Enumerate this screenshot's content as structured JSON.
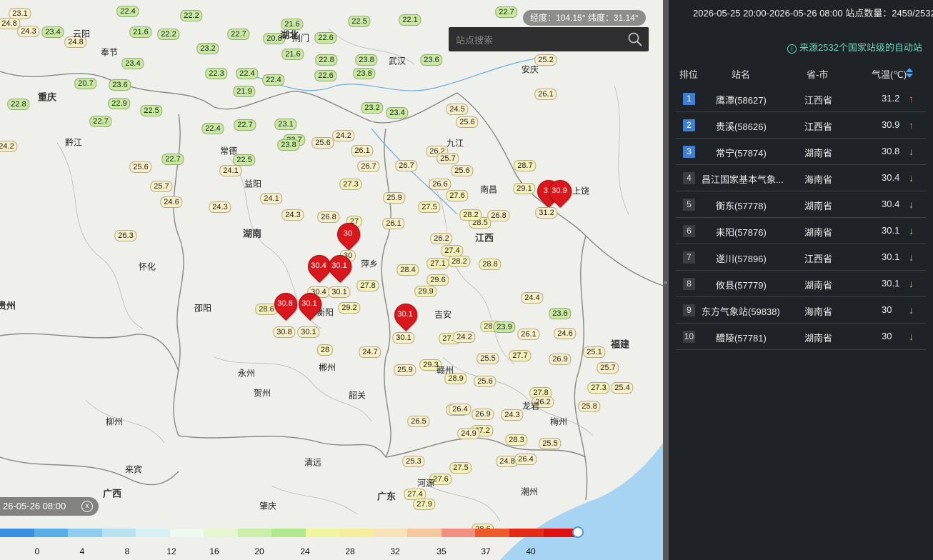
{
  "search": {
    "placeholder": "站点搜索"
  },
  "coords_text": "经度：104.15°  纬度：31.14°",
  "timeline": {
    "label": "26-05-26 08:00",
    "close": "x"
  },
  "colorbar": {
    "colors": [
      "#3a8fe0",
      "#5aaee8",
      "#8fcdf0",
      "#b8e2f2",
      "#d6f0f4",
      "#eefaf0",
      "#e6f7d0",
      "#cbefa8",
      "#b2e88c",
      "#eef6a0",
      "#f6ee9c",
      "#f8e2b8",
      "#f6c8a0",
      "#f19080",
      "#ef5a2a",
      "#e52a16",
      "#e01010"
    ],
    "ticks": [
      "0",
      "4",
      "8",
      "12",
      "16",
      "20",
      "24",
      "28",
      "32",
      "35",
      "37",
      "40"
    ]
  },
  "panel": {
    "period": "2026-05-25 20:00-2026-05-26 08:00  站点数量：2459/2532",
    "source": "来源2532个国家站级的自动站",
    "info_icon": "i",
    "headers": {
      "rank": "排位",
      "name": "站名",
      "province": "省-市",
      "temp": "气温(℃)"
    },
    "sort_icon": "sort-icon",
    "rows": [
      {
        "rank": "1",
        "name": "鹰潭(58627)",
        "province": "江西省",
        "temp": "31.2",
        "trend": "↑",
        "dir": "up"
      },
      {
        "rank": "2",
        "name": "贵溪(58626)",
        "province": "江西省",
        "temp": "30.9",
        "trend": "↑",
        "dir": "up"
      },
      {
        "rank": "3",
        "name": "常宁(57874)",
        "province": "湖南省",
        "temp": "30.8",
        "trend": "↓",
        "dir": "down"
      },
      {
        "rank": "4",
        "name": "昌江国家基本气象...",
        "province": "海南省",
        "temp": "30.4",
        "trend": "↓",
        "dir": "down"
      },
      {
        "rank": "5",
        "name": "衡东(57778)",
        "province": "湖南省",
        "temp": "30.4",
        "trend": "↓",
        "dir": "down"
      },
      {
        "rank": "6",
        "name": "耒阳(57876)",
        "province": "湖南省",
        "temp": "30.1",
        "trend": "↓",
        "dir": "down"
      },
      {
        "rank": "7",
        "name": "遂川(57896)",
        "province": "江西省",
        "temp": "30.1",
        "trend": "↓",
        "dir": "down"
      },
      {
        "rank": "8",
        "name": "攸县(57779)",
        "province": "湖南省",
        "temp": "30.1",
        "trend": "↓",
        "dir": "down"
      },
      {
        "rank": "9",
        "name": "东方气象站(59838)",
        "province": "海南省",
        "temp": "30",
        "trend": "↓",
        "dir": "down"
      },
      {
        "rank": "10",
        "name": "醴陵(57781)",
        "province": "湖南省",
        "temp": "30",
        "trend": "↓",
        "dir": "down"
      }
    ]
  },
  "map": {
    "places": [
      {
        "t": "湖北"
      },
      {
        "t": "重庆"
      },
      {
        "t": "湖南"
      },
      {
        "t": "江西"
      },
      {
        "t": "福建"
      },
      {
        "t": "广西"
      },
      {
        "t": "贵州"
      },
      {
        "t": "荆门"
      },
      {
        "t": "云阳"
      },
      {
        "t": "奉节"
      },
      {
        "t": "黔江"
      },
      {
        "t": "常德"
      },
      {
        "t": "益阳"
      },
      {
        "t": "萍乡"
      },
      {
        "t": "永州"
      },
      {
        "t": "郴州"
      },
      {
        "t": "赣州"
      },
      {
        "t": "龙岩"
      },
      {
        "t": "河源"
      },
      {
        "t": "梅州"
      },
      {
        "t": "潮州"
      },
      {
        "t": "韶关"
      },
      {
        "t": "清远"
      },
      {
        "t": "肇庆"
      },
      {
        "t": "来宾"
      },
      {
        "t": "柳州"
      },
      {
        "t": "贺州"
      },
      {
        "t": "九江"
      },
      {
        "t": "上饶"
      },
      {
        "t": "南昌"
      },
      {
        "t": "衡阳"
      },
      {
        "t": "怀化"
      },
      {
        "t": "安庆"
      },
      {
        "t": "武汉"
      },
      {
        "t": "邵阳"
      },
      {
        "t": "吉安"
      },
      {
        "t": "广东"
      }
    ],
    "pins": [
      {
        "v": "30",
        "sub": "30"
      },
      {
        "v": "30.4",
        "sub": "30.4"
      },
      {
        "v": "30.1",
        "sub": "30.1"
      },
      {
        "v": "30.8",
        "sub": "30.8"
      },
      {
        "v": "30.1",
        "sub": "30.1"
      },
      {
        "v": "30.1",
        "sub": "30.1"
      },
      {
        "v": "31",
        "sub": "31.2"
      },
      {
        "v": "30.9",
        "sub": ""
      }
    ],
    "temps": [
      [
        "23.1",
        "cream"
      ],
      [
        "22.4",
        "green"
      ],
      [
        "22.2",
        "green"
      ],
      [
        "24.8",
        "cream"
      ],
      [
        "22.2",
        "green"
      ],
      [
        "21.6",
        "green"
      ],
      [
        "23.4",
        "green"
      ],
      [
        "21.6",
        "green"
      ],
      [
        "20.8",
        "green"
      ],
      [
        "22.6",
        "green"
      ],
      [
        "22.5",
        "green"
      ],
      [
        "22.1",
        "green"
      ],
      [
        "22.7",
        "green"
      ],
      [
        "22.7",
        "green"
      ],
      [
        "24.3",
        "cream"
      ],
      [
        "24.8",
        "cream"
      ],
      [
        "23.4",
        "green"
      ],
      [
        "23.2",
        "green"
      ],
      [
        "22.8",
        "green"
      ],
      [
        "21.6",
        "green"
      ],
      [
        "23.8",
        "green"
      ],
      [
        "23.6",
        "green"
      ],
      [
        "25.2",
        "cream"
      ],
      [
        "23.8",
        "green"
      ],
      [
        "22.3",
        "green"
      ],
      [
        "22.4",
        "green"
      ],
      [
        "21.9",
        "green"
      ],
      [
        "22.4",
        "green"
      ],
      [
        "20.7",
        "green"
      ],
      [
        "23.6",
        "green"
      ],
      [
        "22.8",
        "green"
      ],
      [
        "22.6",
        "green"
      ],
      [
        "22.9",
        "green"
      ],
      [
        "22.5",
        "green"
      ],
      [
        "24.5",
        "cream"
      ],
      [
        "23.2",
        "green"
      ],
      [
        "23.4",
        "green"
      ],
      [
        "25.6",
        "cream"
      ],
      [
        "26.1",
        "cream"
      ],
      [
        "24.2",
        "cream"
      ],
      [
        "22.7",
        "green"
      ],
      [
        "22.4",
        "green"
      ],
      [
        "22.7",
        "green"
      ],
      [
        "23.1",
        "green"
      ],
      [
        "24.2",
        "cream"
      ],
      [
        "23.7",
        "green"
      ],
      [
        "22.5",
        "green"
      ],
      [
        "23.8",
        "green"
      ],
      [
        "24.1",
        "cream"
      ],
      [
        "25.6",
        "cream"
      ],
      [
        "22.7",
        "green"
      ],
      [
        "25.6",
        "cream"
      ],
      [
        "26.2",
        "cream"
      ],
      [
        "26.7",
        "cream"
      ],
      [
        "24.1",
        "cream"
      ],
      [
        "24.3",
        "cream"
      ],
      [
        "24.6",
        "cream"
      ],
      [
        "25.7",
        "cream"
      ],
      [
        "24.3",
        "cream"
      ],
      [
        "26.3",
        "cream"
      ],
      [
        "26.8",
        "cream"
      ],
      [
        "25.9",
        "cream"
      ],
      [
        "27",
        "yellow"
      ],
      [
        "27.3",
        "yellow"
      ],
      [
        "26.2",
        "cream"
      ],
      [
        "26.6",
        "cream"
      ],
      [
        "25.6",
        "cream"
      ],
      [
        "27.5",
        "yellow"
      ],
      [
        "26.1",
        "cream"
      ],
      [
        "27.6",
        "yellow"
      ],
      [
        "28.7",
        "yellow"
      ],
      [
        "29.1",
        "yellow"
      ],
      [
        "28.4",
        "yellow"
      ],
      [
        "27.4",
        "yellow"
      ],
      [
        "27.1",
        "yellow"
      ],
      [
        "28.2",
        "yellow"
      ],
      [
        "28.8",
        "yellow"
      ],
      [
        "27.8",
        "yellow"
      ],
      [
        "29.6",
        "yellow"
      ],
      [
        "29.9",
        "yellow"
      ],
      [
        "28.5",
        "yellow"
      ],
      [
        "28.2",
        "yellow"
      ],
      [
        "29.3",
        "yellow"
      ],
      [
        "28.9",
        "yellow"
      ],
      [
        "27.9",
        "yellow"
      ],
      [
        "28.7",
        "yellow"
      ],
      [
        "29.2",
        "yellow"
      ],
      [
        "28.6",
        "yellow"
      ],
      [
        "28",
        "yellow"
      ],
      [
        "26.7",
        "cream"
      ],
      [
        "26.1",
        "cream"
      ],
      [
        "25.7",
        "cream"
      ],
      [
        "26.8",
        "cream"
      ],
      [
        "24.7",
        "cream"
      ],
      [
        "25.9",
        "cream"
      ],
      [
        "27.7",
        "yellow"
      ],
      [
        "26.6",
        "cream"
      ],
      [
        "27.2",
        "yellow"
      ],
      [
        "28.3",
        "yellow"
      ],
      [
        "26.9",
        "cream"
      ],
      [
        "27.8",
        "yellow"
      ],
      [
        "26.5",
        "cream"
      ],
      [
        "25.3",
        "cream"
      ],
      [
        "24.8",
        "cream"
      ],
      [
        "26.4",
        "cream"
      ],
      [
        "25.5",
        "cream"
      ],
      [
        "24.9",
        "cream"
      ],
      [
        "24.3",
        "cream"
      ],
      [
        "26.2",
        "cream"
      ],
      [
        "25.8",
        "cream"
      ],
      [
        "25.7",
        "cream"
      ],
      [
        "27.3",
        "yellow"
      ],
      [
        "26.9",
        "cream"
      ],
      [
        "24.6",
        "cream"
      ],
      [
        "25.1",
        "cream"
      ],
      [
        "25.4",
        "cream"
      ],
      [
        "23.6",
        "green"
      ],
      [
        "26.1",
        "cream"
      ],
      [
        "25.6",
        "cream"
      ],
      [
        "24.2",
        "cream"
      ],
      [
        "24.4",
        "cream"
      ],
      [
        "23.9",
        "green"
      ],
      [
        "25.5",
        "cream"
      ],
      [
        "26.4",
        "cream"
      ],
      [
        "27.6",
        "yellow"
      ],
      [
        "27.4",
        "yellow"
      ],
      [
        "27.9",
        "yellow"
      ],
      [
        "28.6",
        "yellow"
      ],
      [
        "27.5",
        "yellow"
      ],
      [
        "26.3",
        "cream"
      ],
      [
        "27.4",
        "yellow"
      ],
      [
        "24.9",
        "cream"
      ],
      [
        "25.2",
        "cream"
      ]
    ]
  }
}
